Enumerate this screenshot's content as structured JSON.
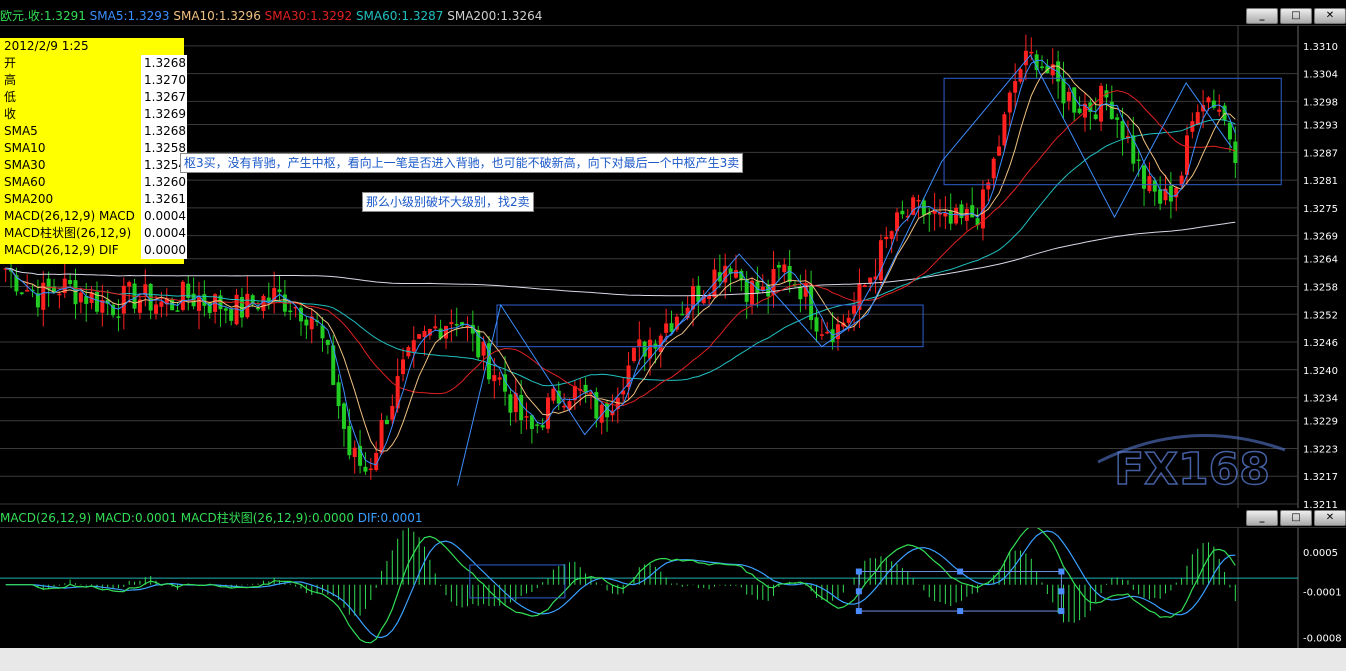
{
  "price_panel": {
    "legend": [
      {
        "text": "欧元.收:1.3291",
        "color": "#33dd55"
      },
      {
        "text": "SMA5:1.3293",
        "color": "#3b8eff"
      },
      {
        "text": "SMA10:1.3296",
        "color": "#f0c080"
      },
      {
        "text": "SMA30:1.3292",
        "color": "#e02020"
      },
      {
        "text": "SMA60:1.3287",
        "color": "#20c0c0"
      },
      {
        "text": "SMA200:1.3264",
        "color": "#d0d0d0"
      }
    ],
    "window_buttons": [
      "_",
      "□",
      "✕"
    ],
    "y_ticks": [
      "1.3310",
      "1.3304",
      "1.3298",
      "1.3293",
      "1.3287",
      "1.3281",
      "1.3275",
      "1.3269",
      "1.3264",
      "1.3258",
      "1.3252",
      "1.3246",
      "1.3240",
      "1.3234",
      "1.3229",
      "1.3223",
      "1.3217",
      "1.3211"
    ],
    "watermark": "FX168"
  },
  "info_box": {
    "date": "2012/2/9 1:25",
    "rows": [
      {
        "label": "开",
        "value": "1.3268"
      },
      {
        "label": "高",
        "value": "1.3270"
      },
      {
        "label": "低",
        "value": "1.3267"
      },
      {
        "label": "收",
        "value": "1.3269"
      },
      {
        "label": "SMA5",
        "value": "1.3268"
      },
      {
        "label": "SMA10",
        "value": "1.3258"
      },
      {
        "label": "SMA30",
        "value": "1.3254"
      },
      {
        "label": "SMA60",
        "value": "1.3260"
      },
      {
        "label": "SMA200",
        "value": "1.3261"
      },
      {
        "label": "MACD(26,12,9) MACD",
        "value": "0.0004"
      },
      {
        "label": "MACD柱状图(26,12,9)",
        "value": "0.0004"
      },
      {
        "label": "MACD(26,12,9) DIF",
        "value": "0.0000"
      }
    ]
  },
  "annotations": {
    "note1": "枢3买，没有背驰，产生中枢，看向上一笔是否进入背驰，也可能不破新高，向下对最后一个中枢产生3卖",
    "note2": "那么小级别破坏大级别，找2卖"
  },
  "macd_panel": {
    "legend": [
      {
        "text": "MACD(26,12,9) MACD:0.0001",
        "color": "#33dd55"
      },
      {
        "text": "MACD柱状图(26,12,9):0.0000",
        "color": "#33dd55"
      },
      {
        "text": "DIF:0.0001",
        "color": "#3aa0ff"
      }
    ],
    "window_buttons": [
      "_",
      "□",
      "✕"
    ],
    "y_ticks": [
      "0.0005",
      "-0.0001",
      "-0.0008"
    ]
  },
  "colors": {
    "up": "#ff2020",
    "down": "#22cc22",
    "grid": "#3a3a3a",
    "box": "#3060d0"
  },
  "chart_data": {
    "type": "candlestick",
    "price_ylim": [
      1.3211,
      1.3313
    ],
    "close_path": [
      1.3262,
      1.3258,
      1.3256,
      1.3258,
      1.3257,
      1.3255,
      1.3254,
      1.3256,
      1.3255,
      1.3254,
      1.3256,
      1.3255,
      1.3254,
      1.3253,
      1.3255,
      1.3256,
      1.3254,
      1.3252,
      1.324,
      1.3222,
      1.3218,
      1.323,
      1.324,
      1.3246,
      1.325,
      1.3252,
      1.3245,
      1.324,
      1.3233,
      1.3226,
      1.3232,
      1.3236,
      1.3234,
      1.323,
      1.3238,
      1.3244,
      1.3248,
      1.3252,
      1.3256,
      1.326,
      1.3264,
      1.3258,
      1.3256,
      1.3262,
      1.3258,
      1.325,
      1.3249,
      1.3254,
      1.3262,
      1.327,
      1.3274,
      1.3274,
      1.3271,
      1.3272,
      1.3275,
      1.329,
      1.3305,
      1.3308,
      1.3302,
      1.3298,
      1.3297,
      1.3299,
      1.329,
      1.328,
      1.3276,
      1.3282,
      1.33,
      1.3298,
      1.3288
    ],
    "macd_ylim": [
      -0.0009,
      0.0008
    ]
  }
}
